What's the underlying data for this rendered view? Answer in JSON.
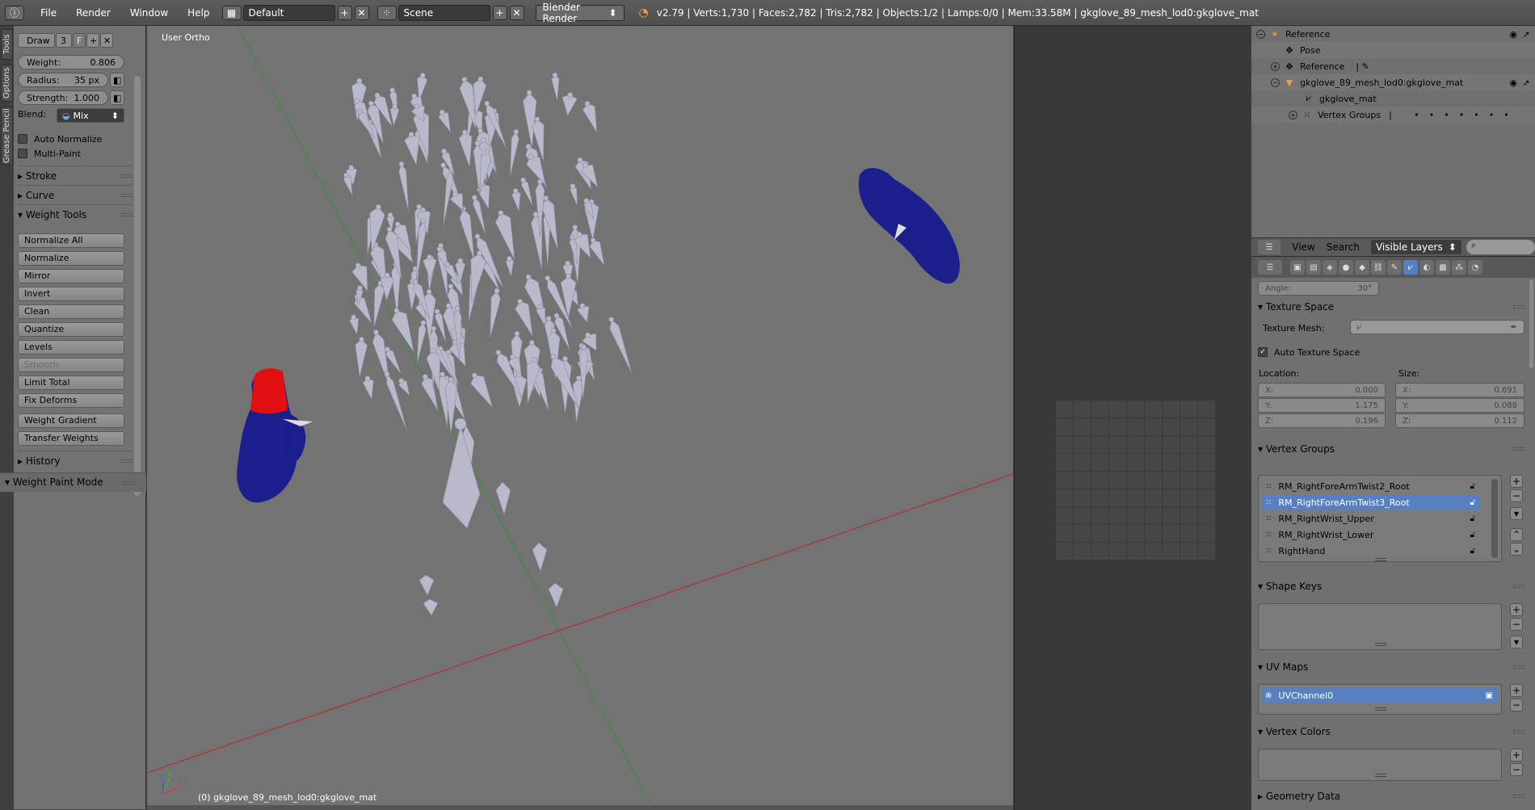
{
  "topbar": {
    "menus": [
      "File",
      "Render",
      "Window",
      "Help"
    ],
    "layout": "Default",
    "scene": "Scene",
    "engine": "Blender Render",
    "stats": "v2.79 | Verts:1,730 | Faces:2,782 | Tris:2,782 | Objects:1/2 | Lamps:0/0 | Mem:33.58M | gkglove_89_mesh_lod0:gkglove_mat"
  },
  "vtabs": [
    "Tools",
    "Options",
    "Grease Pencil"
  ],
  "tools": {
    "brush_name": "Draw",
    "brush_users": "3",
    "brush_fake": "F",
    "weight": {
      "label": "Weight:",
      "value": "0.806"
    },
    "radius": {
      "label": "Radius:",
      "value": "35 px"
    },
    "strength": {
      "label": "Strength:",
      "value": "1.000"
    },
    "blend": {
      "label": "Blend:",
      "value": "Mix"
    },
    "auto_normalize": "Auto Normalize",
    "multi_paint": "Multi-Paint",
    "stroke": "Stroke",
    "curve": "Curve",
    "weight_tools": "Weight Tools",
    "buttons": [
      "Normalize All",
      "Normalize",
      "Mirror",
      "Invert",
      "Clean",
      "Quantize",
      "Levels",
      "Smooth",
      "Limit Total",
      "Fix Deforms",
      "Weight Gradient",
      "Transfer Weights"
    ],
    "history": "History",
    "mode": "Weight Paint Mode"
  },
  "viewport": {
    "view_label": "User Ortho",
    "object_label": "(0) gkglove_89_mesh_lod0:gkglove_mat",
    "axis_x": "x",
    "axis_y": "y",
    "axis_z": "z"
  },
  "outliner": {
    "rows": [
      {
        "label": "Reference",
        "icon": "armature-icon"
      },
      {
        "label": "Pose",
        "icon": "pose-icon"
      },
      {
        "label": "Reference",
        "icon": "armature-data-icon"
      },
      {
        "label": "gkglove_89_mesh_lod0:gkglove_mat",
        "icon": "mesh-object-icon"
      },
      {
        "label": "gkglove_mat",
        "icon": "mesh-data-icon"
      },
      {
        "label": "Vertex Groups",
        "icon": "vertex-groups-icon"
      }
    ],
    "header": {
      "view": "View",
      "search": "Search",
      "filter": "Visible Layers"
    }
  },
  "properties": {
    "angle": {
      "label": "Angle:",
      "value": "30°"
    },
    "texture_space": "Texture Space",
    "texture_mesh": "Texture Mesh:",
    "auto_texture_space": "Auto Texture Space",
    "location_label": "Location:",
    "size_label": "Size:",
    "location": [
      {
        "axis": "X:",
        "value": "0.000"
      },
      {
        "axis": "Y:",
        "value": "1.175"
      },
      {
        "axis": "Z:",
        "value": "0.196"
      }
    ],
    "size": [
      {
        "axis": "X:",
        "value": "0.691"
      },
      {
        "axis": "Y:",
        "value": "0.088"
      },
      {
        "axis": "Z:",
        "value": "0.112"
      }
    ],
    "vertex_groups": "Vertex Groups",
    "vg_items": [
      "RM_RightForeArmTwist2_Root",
      "RM_RightForeArmTwist3_Root",
      "RM_RightWrist_Upper",
      "RM_RightWrist_Lower",
      "RightHand"
    ],
    "shape_keys": "Shape Keys",
    "uv_maps": "UV Maps",
    "uv_item": "UVChannel0",
    "vertex_colors": "Vertex Colors",
    "geometry_data": "Geometry Data"
  },
  "colors": {
    "selection": "#5680c2",
    "glove_blue": "#1a1f8c",
    "glove_red": "#e01010",
    "bone": "#b9b9cc"
  }
}
